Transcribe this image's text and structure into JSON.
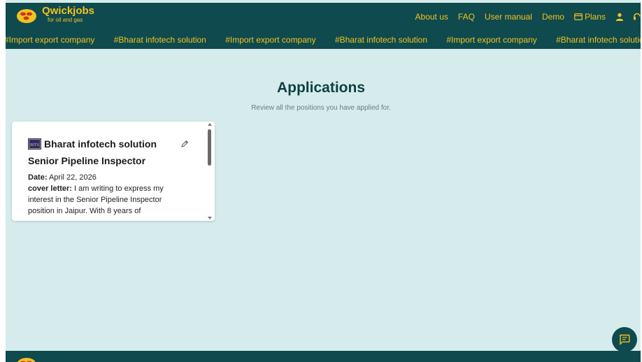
{
  "header": {
    "brand_name": "Qwickjobs",
    "brand_tagline": "for oil and gas",
    "nav": {
      "about": "About us",
      "faq": "FAQ",
      "user_manual": "User manual",
      "demo": "Demo",
      "plans": "Plans"
    }
  },
  "ticker": [
    "#Import export company",
    "#Bharat infotech solution",
    "#Import export company",
    "#Bharat infotech solution",
    "#Import export company",
    "#Bharat infotech solution"
  ],
  "page": {
    "title": "Applications",
    "subtitle": "Review all the positions you have applied for."
  },
  "application": {
    "company": "Bharat infotech solution",
    "company_logo_text": "BITS",
    "position": "Senior Pipeline Inspector",
    "date_label": "Date:",
    "date": "April 22, 2026",
    "cover_label": "cover letter:",
    "cover_text": "I am writing to express my interest in the Senior Pipeline Inspector position in Jaipur. With 8 years of"
  },
  "colors": {
    "primary": "#0e4a4e",
    "accent": "#f3c220",
    "background": "#d6ecec"
  },
  "icons": {
    "edit": "pencil-icon",
    "chat": "chat-icon",
    "user": "user-icon",
    "support": "headset-icon",
    "plans": "card-icon"
  }
}
